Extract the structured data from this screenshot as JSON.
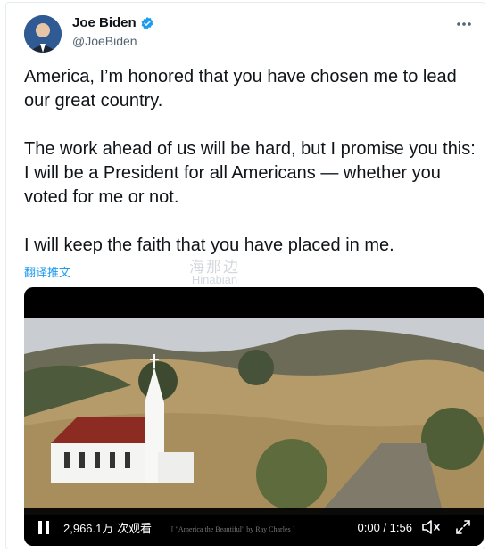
{
  "user": {
    "name": "Joe Biden",
    "handle": "@JoeBiden",
    "verified": true
  },
  "tweet": {
    "paragraphs": [
      "America, I’m honored that you have chosen me to lead our great country.",
      "The work ahead of us will be hard, but I promise you this: I will be a President for all Americans — whether you voted for me or not.",
      "I will keep the faith that you have placed in me."
    ],
    "translate_label": "翻译推文"
  },
  "watermark": {
    "cn": "海那边",
    "en": "Hinabian"
  },
  "video": {
    "views": "2,966.1万 次观看",
    "caption": "[ \"America the Beautiful\" by Ray Charles ]",
    "time": "0:00 / 1:56"
  },
  "colors": {
    "verified_blue": "#1d9bf0",
    "link_blue": "#1d9bf0",
    "text": "#0f1419",
    "secondary": "#536471"
  },
  "icons": {
    "more": "more-icon",
    "pause": "pause-icon",
    "volume": "volume-muted-icon",
    "fullscreen": "fullscreen-icon"
  }
}
